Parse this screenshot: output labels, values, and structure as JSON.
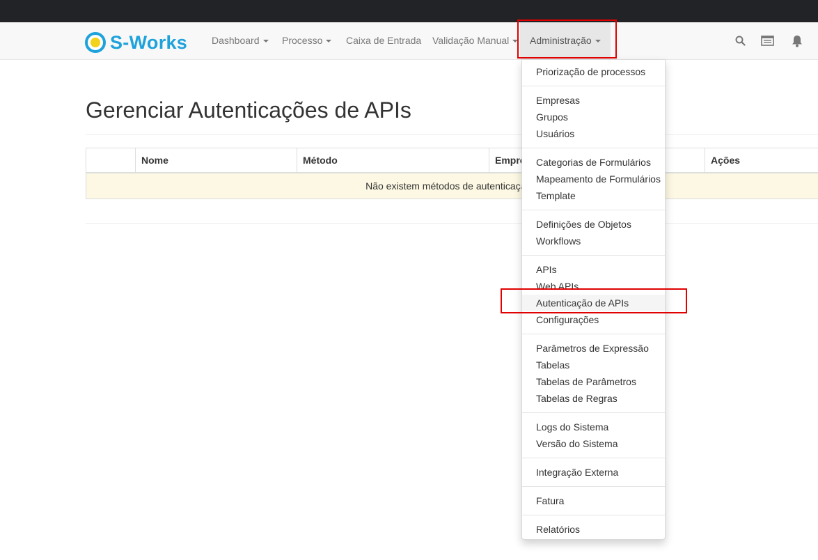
{
  "brand": {
    "name": "S-Works",
    "accent": "#1ea2db",
    "dot_color": "#f2d21b"
  },
  "nav": {
    "items": [
      {
        "label": "Dashboard",
        "dropdown": true
      },
      {
        "label": "Processo",
        "dropdown": true
      },
      {
        "label": "Caixa de Entrada",
        "dropdown": false
      },
      {
        "label": "Validação Manual",
        "dropdown": true
      },
      {
        "label": "Administração",
        "dropdown": true,
        "active": true
      }
    ],
    "icons": [
      "search-icon",
      "inbox-icon",
      "bell-icon"
    ]
  },
  "page": {
    "title": "Gerenciar Autenticações de APIs",
    "table": {
      "columns": [
        "",
        "Nome",
        "Método",
        "Empre",
        "Ações"
      ],
      "empty_message": "Não existem métodos de autenticação ca"
    }
  },
  "admin_menu": {
    "groups": [
      [
        "Priorização de processos"
      ],
      [
        "Empresas",
        "Grupos",
        "Usuários"
      ],
      [
        "Categorias de Formulários",
        "Mapeamento de Formulários",
        "Template"
      ],
      [
        "Definições de Objetos",
        "Workflows"
      ],
      [
        "APIs",
        "Web APIs",
        "Autenticação de APIs",
        "Configurações"
      ],
      [
        "Parâmetros de Expressão",
        "Tabelas",
        "Tabelas de Parâmetros",
        "Tabelas de Regras"
      ],
      [
        "Logs do Sistema",
        "Versão do Sistema"
      ],
      [
        "Integração Externa"
      ],
      [
        "Fatura"
      ],
      [
        "Relatórios"
      ]
    ],
    "selected": "Autenticação de APIs"
  },
  "annotation_color": "#e00000"
}
